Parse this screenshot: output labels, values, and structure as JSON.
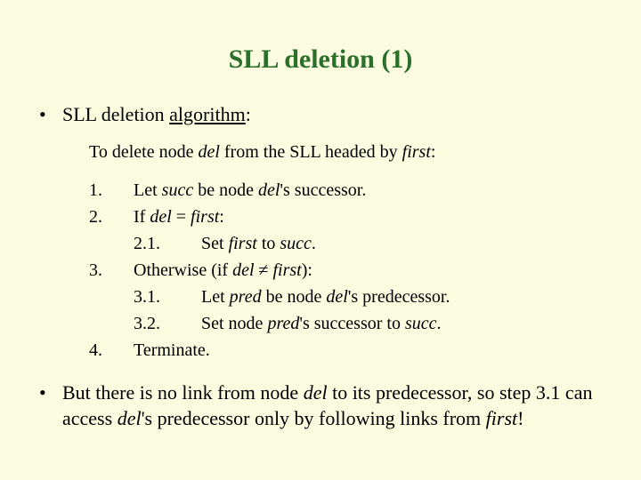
{
  "title": "SLL deletion (1)",
  "bullet1": {
    "heading_pre": "SLL deletion ",
    "heading_ul": "algorithm",
    "heading_post": ":"
  },
  "intro": {
    "pre": "To delete node ",
    "del": "del",
    "mid": " from the SLL headed by ",
    "first": "first",
    "post": ":"
  },
  "steps": {
    "n1": "1.",
    "s1_pre": "Let ",
    "s1_succ": "succ",
    "s1_mid": " be node ",
    "s1_del": "del",
    "s1_post": "'s successor.",
    "n2": "2.",
    "s2_pre": "If ",
    "s2_del": "del",
    "s2_eq": " = ",
    "s2_first": "first",
    "s2_post": ":",
    "n2_1": "2.1.",
    "s2_1_pre": "Set ",
    "s2_1_first": "first",
    "s2_1_mid": " to ",
    "s2_1_succ": "succ",
    "s2_1_post": ".",
    "n3": "3.",
    "s3_pre": "Otherwise (if ",
    "s3_del": "del",
    "s3_neq": " ≠ ",
    "s3_first": "first",
    "s3_post": "):",
    "n3_1": "3.1.",
    "s3_1_pre": "Let ",
    "s3_1_pred": "pred",
    "s3_1_mid": " be node ",
    "s3_1_del": "del",
    "s3_1_post": "'s predecessor.",
    "n3_2": "3.2.",
    "s3_2_pre": "Set node ",
    "s3_2_pred": "pred",
    "s3_2_mid": "'s successor to ",
    "s3_2_succ": "succ",
    "s3_2_post": ".",
    "n4": "4.",
    "s4": "Terminate."
  },
  "bullet2": {
    "pre": "But there is no link from node ",
    "del1": "del",
    "mid1": " to its predecessor, so step 3.1 can access ",
    "del2": "del",
    "mid2": "'s predecessor only by following links from ",
    "first": "first",
    "post": "!"
  },
  "bulletdot": "•"
}
